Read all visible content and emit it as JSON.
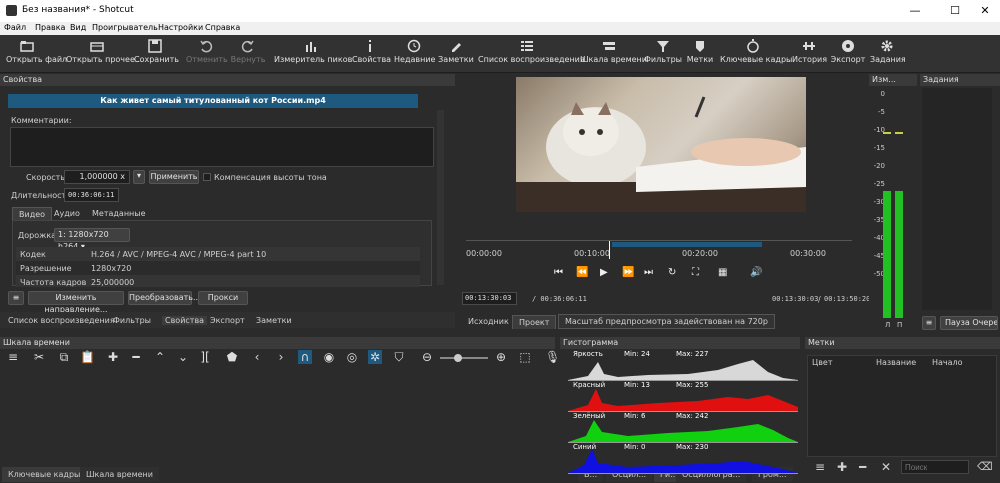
{
  "window": {
    "title": "Без названия* - Shotcut",
    "min": "—",
    "max": "☐",
    "close": "✕"
  },
  "menu": [
    "Файл",
    "Правка",
    "Вид",
    "Проигрыватель",
    "Настройки",
    "Справка"
  ],
  "toolbar": {
    "open": "Открыть файл",
    "open_other": "Открыть прочее...",
    "save": "Сохранить",
    "undo": "Отменить",
    "redo": "Вернуть",
    "peak": "Измеритель пиков",
    "properties": "Свойства",
    "recent": "Недавние",
    "notes": "Заметки",
    "playlist": "Список воспроизведения",
    "timeline": "Шкала времени",
    "filters": "Фильтры",
    "markers": "Метки",
    "keyframes": "Ключевые кадры",
    "history": "История",
    "export": "Экспорт",
    "jobs": "Задания"
  },
  "properties": {
    "title": "Свойства",
    "filename": "Как живет самый титулованный кот России.mp4",
    "comments_label": "Комментарии:",
    "speed_label": "Скорость",
    "speed_value": "1,000000 x",
    "apply": "Применить",
    "pitch": "Компенсация высоты тона",
    "duration_label": "Длительность",
    "duration_value": "00:36:06:11",
    "tabs": [
      "Видео",
      "Аудио",
      "Метаданные"
    ],
    "track_label": "Дорожка",
    "track_value": "1: 1280x720 h264",
    "rows": [
      {
        "k": "Кодек",
        "v": "H.264 / AVC / MPEG-4 AVC / MPEG-4 part 10"
      },
      {
        "k": "Разрешение",
        "v": "1280x720"
      },
      {
        "k": "Частота кадров",
        "v": "25,000000"
      }
    ],
    "reverse": "Изменить направление...",
    "convert": "Преобразовать...",
    "proxy": "Прокси",
    "bottom_tabs": [
      "Список воспроизведения",
      "Фильтры",
      "Свойства",
      "Экспорт",
      "Заметки"
    ]
  },
  "player": {
    "ruler": [
      "00:00:00",
      "00:10:00",
      "00:20:00",
      "00:30:00"
    ],
    "position": "00:13:30:03",
    "total": "/ 00:36:06:11",
    "in": "00:13:30:03",
    "sep": "/",
    "out": "00:13:50:20",
    "tabs": [
      "Исходник",
      "Проект"
    ],
    "preview_note": "Масштаб предпросмотра задействован на 720р",
    "progress": 0.37
  },
  "meter": {
    "title": "Изм...",
    "labels": [
      "0",
      "-5",
      "-10",
      "-15",
      "-20",
      "-25",
      "-30",
      "-35",
      "-40",
      "-45",
      "-50"
    ],
    "channels": [
      "Л",
      "П"
    ],
    "level": 0.72
  },
  "jobs": {
    "title": "Задания",
    "pause": "Пауза Очереди"
  },
  "timeline": {
    "title": "Шкала времени",
    "bottom_tabs": [
      "Ключевые кадры",
      "Шкала времени"
    ]
  },
  "histogram": {
    "title": "Гистограмма",
    "scopes": [
      {
        "name": "Яркость",
        "min": "Min: 24",
        "max": "Max: 227",
        "color": "#d8d8d8"
      },
      {
        "name": "Красный",
        "min": "Min: 13",
        "max": "Max: 255",
        "color": "#e01010"
      },
      {
        "name": "Зелёный",
        "min": "Min: 6",
        "max": "Max: 242",
        "color": "#10d010"
      },
      {
        "name": "Синий",
        "min": "Min: 0",
        "max": "Max: 230",
        "color": "#1010e0"
      }
    ],
    "bottom_tabs": [
      "В...",
      "Осцил...",
      "Ги...",
      "Осциллогра...",
      "Гром..."
    ]
  },
  "markers": {
    "title": "Метки",
    "cols": [
      "Цвет",
      "Название",
      "Начало"
    ],
    "search_placeholder": "Поиск"
  },
  "colors": {
    "accent": "#1e5a80",
    "panel": "#2b2b2b",
    "meter": "#22c022"
  }
}
